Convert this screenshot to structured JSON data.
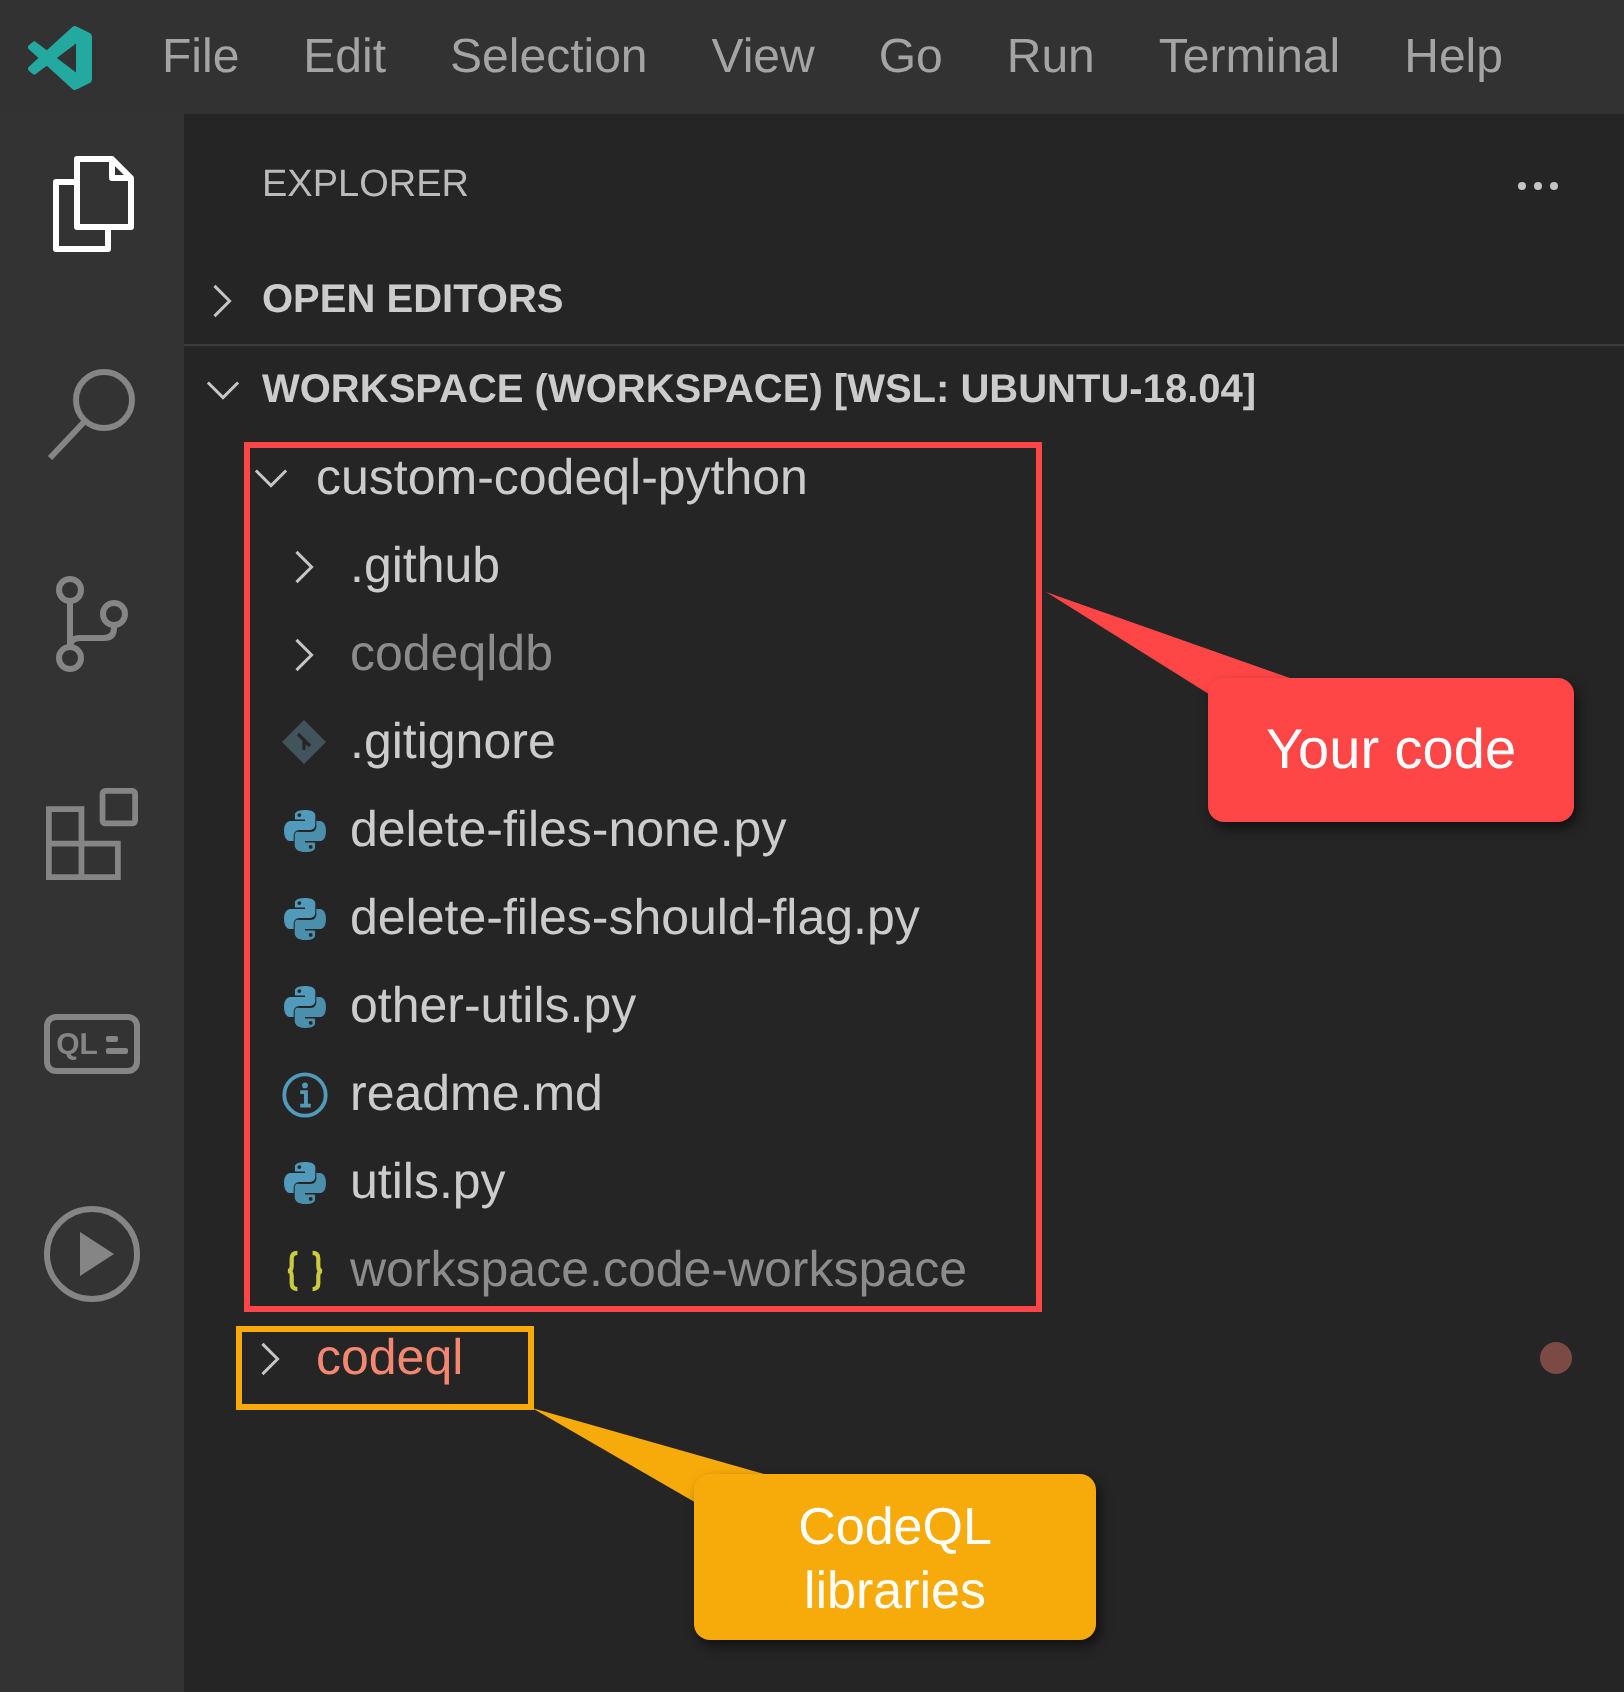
{
  "menu_bar": {
    "items": [
      "File",
      "Edit",
      "Selection",
      "View",
      "Go",
      "Run",
      "Terminal",
      "Help"
    ]
  },
  "activity_bar": {
    "items": [
      {
        "kind": "explorer",
        "selected": true
      },
      {
        "kind": "search",
        "selected": false
      },
      {
        "kind": "source_control",
        "selected": false
      },
      {
        "kind": "extensions",
        "selected": false
      },
      {
        "kind": "codeql",
        "label": "QL",
        "selected": false
      },
      {
        "kind": "run",
        "selected": false
      }
    ]
  },
  "sidebar": {
    "title": "EXPLORER",
    "sections": [
      {
        "title": "OPEN EDITORS",
        "expanded": false
      },
      {
        "title": "WORKSPACE (WORKSPACE) [WSL: UBUNTU-18.04]",
        "expanded": true,
        "tree": [
          {
            "name": "custom-codeql-python",
            "kind": "folder",
            "expanded": true,
            "dimmed": false,
            "problem": false,
            "children": [
              {
                "name": ".github",
                "kind": "folder",
                "expanded": false,
                "dimmed": false,
                "problem": false
              },
              {
                "name": "codeqldb",
                "kind": "folder",
                "expanded": false,
                "dimmed": true,
                "problem": false
              },
              {
                "name": ".gitignore",
                "kind": "git",
                "dimmed": false,
                "problem": false
              },
              {
                "name": "delete-files-none.py",
                "kind": "python",
                "dimmed": false,
                "problem": false
              },
              {
                "name": "delete-files-should-flag.py",
                "kind": "python",
                "dimmed": false,
                "problem": false
              },
              {
                "name": "other-utils.py",
                "kind": "python",
                "dimmed": false,
                "problem": false
              },
              {
                "name": "readme.md",
                "kind": "info",
                "dimmed": false,
                "problem": false
              },
              {
                "name": "utils.py",
                "kind": "python",
                "dimmed": false,
                "problem": false
              },
              {
                "name": "workspace.code-workspace",
                "kind": "json",
                "dimmed": true,
                "problem": false
              }
            ]
          },
          {
            "name": "codeql",
            "kind": "folder",
            "expanded": false,
            "dimmed": false,
            "problem": true
          }
        ]
      }
    ]
  },
  "annotations": [
    {
      "text": "Your code",
      "color": "#ff4646"
    },
    {
      "text": "CodeQL libraries",
      "color": "#f7ab0a"
    }
  ]
}
